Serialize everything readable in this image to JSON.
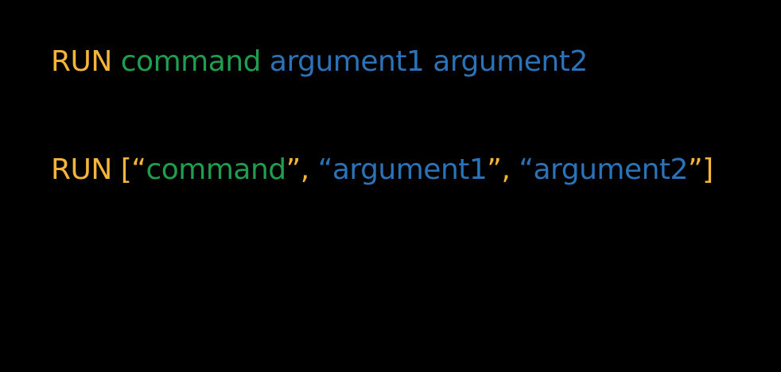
{
  "colors": {
    "keyword": "#f4b53a",
    "command": "#1f9e4f",
    "argument": "#2b73b8",
    "background": "#000000"
  },
  "shell_form": {
    "keyword": "RUN",
    "command": "command",
    "arg1": "argument1",
    "arg2": "argument2"
  },
  "exec_form": {
    "keyword": "RUN",
    "open": "[“",
    "command": "command",
    "sep1": "”,",
    "quote2": "“",
    "arg1": "argument1",
    "sep2": "”,",
    "quote3": "“",
    "arg2": "argument2",
    "close": "”]"
  }
}
